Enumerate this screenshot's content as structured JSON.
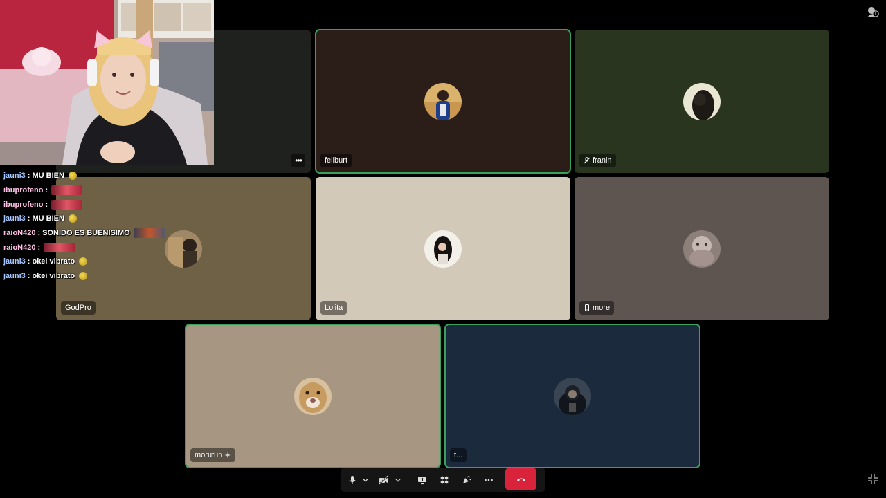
{
  "tiles": [
    {
      "name": "",
      "color": "#1f211e"
    },
    {
      "name": "feliburt",
      "color": "#2b1d18"
    },
    {
      "name": "franin",
      "color": "#29351f",
      "icon": "mic-off-icon"
    },
    {
      "name": "GodPro",
      "color": "#6e6146"
    },
    {
      "name": "Lolita",
      "color": "#d3c9b9"
    },
    {
      "name": "more",
      "color": "#5f5550",
      "icon": "phone-icon"
    },
    {
      "name": "morufun",
      "color": "#a69682",
      "icon": "sparkle-icon"
    },
    {
      "name": "t...",
      "color": "#1b2a3c"
    }
  ],
  "chat": [
    {
      "user": "jauni3",
      "user_color": "#a7c7ff",
      "message": "MU BIEN",
      "emote": "hands-emote"
    },
    {
      "user": "ibuprofeno",
      "user_color": "#ffc2e6",
      "message": "",
      "emote": "red-emote"
    },
    {
      "user": "ibuprofeno",
      "user_color": "#ffc2e6",
      "message": "",
      "emote": "red-emote"
    },
    {
      "user": "jauni3",
      "user_color": "#a7c7ff",
      "message": "MU BIEN",
      "emote": "hands-emote"
    },
    {
      "user": "raioN420",
      "user_color": "#ffc2e6",
      "message": "SONIDO ES BUENISIMO",
      "emote": "banner-emote"
    },
    {
      "user": "raioN420",
      "user_color": "#ffc2e6",
      "message": "",
      "emote": "red-emote"
    },
    {
      "user": "jauni3",
      "user_color": "#a7c7ff",
      "message": "okei vibrato",
      "emote": "coin-emote"
    },
    {
      "user": "jauni3",
      "user_color": "#a7c7ff",
      "message": "okei vibrato",
      "emote": "coin-emote"
    }
  ],
  "toolbar": {
    "buttons": [
      "mic-icon",
      "chevron-down-icon",
      "camera-off-icon",
      "chevron-down-icon",
      "screen-share-icon",
      "activities-icon",
      "soundboard-icon",
      "more-icon"
    ],
    "leave": "phone-hangup-icon"
  },
  "top_right_icon": "activity-badge-icon",
  "bottom_right_icon": "exit-fullscreen-icon",
  "colors": {
    "speaking": "#3aa05a",
    "leave": "#d9233a",
    "toolbar": "#151515"
  }
}
